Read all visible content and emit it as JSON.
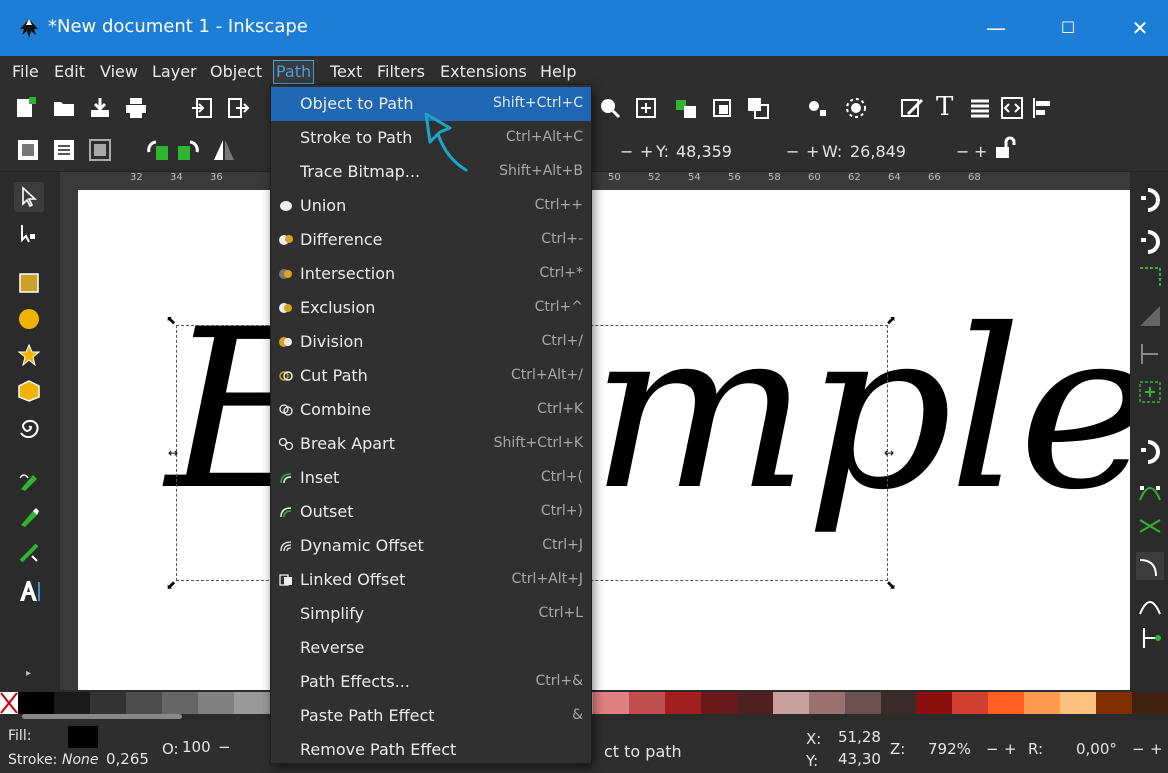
{
  "window": {
    "title": "*New document 1 - Inkscape",
    "minimize": "—",
    "maximize": "☐",
    "close": "✕"
  },
  "menubar": {
    "items": [
      "File",
      "Edit",
      "View",
      "Layer",
      "Object",
      "Path",
      "Text",
      "Filters",
      "Extensions",
      "Help"
    ],
    "active": "Path"
  },
  "toolbar": {
    "y_label": "Y:",
    "y_value": "48,359",
    "w_label": "W:",
    "w_value": "26,849",
    "minus": "−",
    "plus": "+"
  },
  "ruler": {
    "h_numbers": [
      "32",
      "34",
      "36",
      "50",
      "52",
      "54",
      "56",
      "58",
      "60",
      "62",
      "64",
      "66",
      "68"
    ]
  },
  "canvas": {
    "sample_text": "Example"
  },
  "path_menu": {
    "items": [
      {
        "label": "Object to Path",
        "shortcut": "Shift+Ctrl+C",
        "icon": "",
        "highlighted": true
      },
      {
        "label": "Stroke to Path",
        "shortcut": "Ctrl+Alt+C",
        "icon": ""
      },
      {
        "label": "Trace Bitmap...",
        "shortcut": "Shift+Alt+B",
        "icon": ""
      },
      {
        "label": "Union",
        "shortcut": "Ctrl++",
        "icon": "union-icon"
      },
      {
        "label": "Difference",
        "shortcut": "Ctrl+-",
        "icon": "difference-icon"
      },
      {
        "label": "Intersection",
        "shortcut": "Ctrl+*",
        "icon": "intersection-icon"
      },
      {
        "label": "Exclusion",
        "shortcut": "Ctrl+^",
        "icon": "exclusion-icon"
      },
      {
        "label": "Division",
        "shortcut": "Ctrl+/",
        "icon": "division-icon"
      },
      {
        "label": "Cut Path",
        "shortcut": "Ctrl+Alt+/",
        "icon": "cut-path-icon"
      },
      {
        "label": "Combine",
        "shortcut": "Ctrl+K",
        "icon": "combine-icon"
      },
      {
        "label": "Break Apart",
        "shortcut": "Shift+Ctrl+K",
        "icon": "break-apart-icon"
      },
      {
        "label": "Inset",
        "shortcut": "Ctrl+(",
        "icon": "inset-icon"
      },
      {
        "label": "Outset",
        "shortcut": "Ctrl+)",
        "icon": "outset-icon"
      },
      {
        "label": "Dynamic Offset",
        "shortcut": "Ctrl+J",
        "icon": "dynamic-offset-icon"
      },
      {
        "label": "Linked Offset",
        "shortcut": "Ctrl+Alt+J",
        "icon": "linked-offset-icon"
      },
      {
        "label": "Simplify",
        "shortcut": "Ctrl+L",
        "icon": ""
      },
      {
        "label": "Reverse",
        "shortcut": "",
        "icon": ""
      },
      {
        "label": "Path Effects...",
        "shortcut": "Ctrl+&",
        "icon": ""
      },
      {
        "label": "Paste Path Effect",
        "shortcut": "&",
        "icon": ""
      },
      {
        "label": "Remove Path Effect",
        "shortcut": "",
        "icon": ""
      }
    ]
  },
  "status": {
    "fill_label": "Fill:",
    "stroke_label": "Stroke:",
    "stroke_value": "None",
    "stroke_width": "0,265",
    "opacity_label": "O:",
    "opacity_value": "100",
    "minus": "−",
    "message": "ct to path",
    "x_label": "X:",
    "x_value": "51,28",
    "y_label": "Y:",
    "y_value": "43,30",
    "zoom_label": "Z:",
    "zoom_value": "792%",
    "rotation_label": "R:",
    "rotation_value": "0,00°"
  },
  "colors": {
    "titlebar": "#1c7ed6",
    "menu_highlight": "#1f67b3",
    "accent": "#45a0e0",
    "tool_yellow": "#f0b400"
  }
}
